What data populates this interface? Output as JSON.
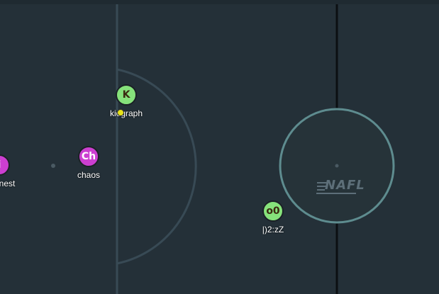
{
  "colors": {
    "field": "#243038",
    "lines": "#384a55",
    "center_circle": "#5e8c8f",
    "halfway_line": "#0b0f12",
    "green_team": "#86e27b",
    "purple_team": "#cc3fd1",
    "ball": "#e6e21a",
    "green_text": "#3a2a10",
    "purple_text": "#ffffff"
  },
  "logo_text": "NAFL",
  "players": [
    {
      "id": "kiograph",
      "avatar": "K",
      "name": "kiograph",
      "team": "green"
    },
    {
      "id": "chaos",
      "avatar": "Ch",
      "name": "chaos",
      "team": "purple"
    },
    {
      "id": "nest",
      "avatar": "i",
      "name": "nest",
      "team": "purple"
    },
    {
      "id": "o0",
      "avatar": "o0",
      "name": "|)2:zZ",
      "team": "green"
    }
  ],
  "ball": {
    "color_name": "ball"
  }
}
